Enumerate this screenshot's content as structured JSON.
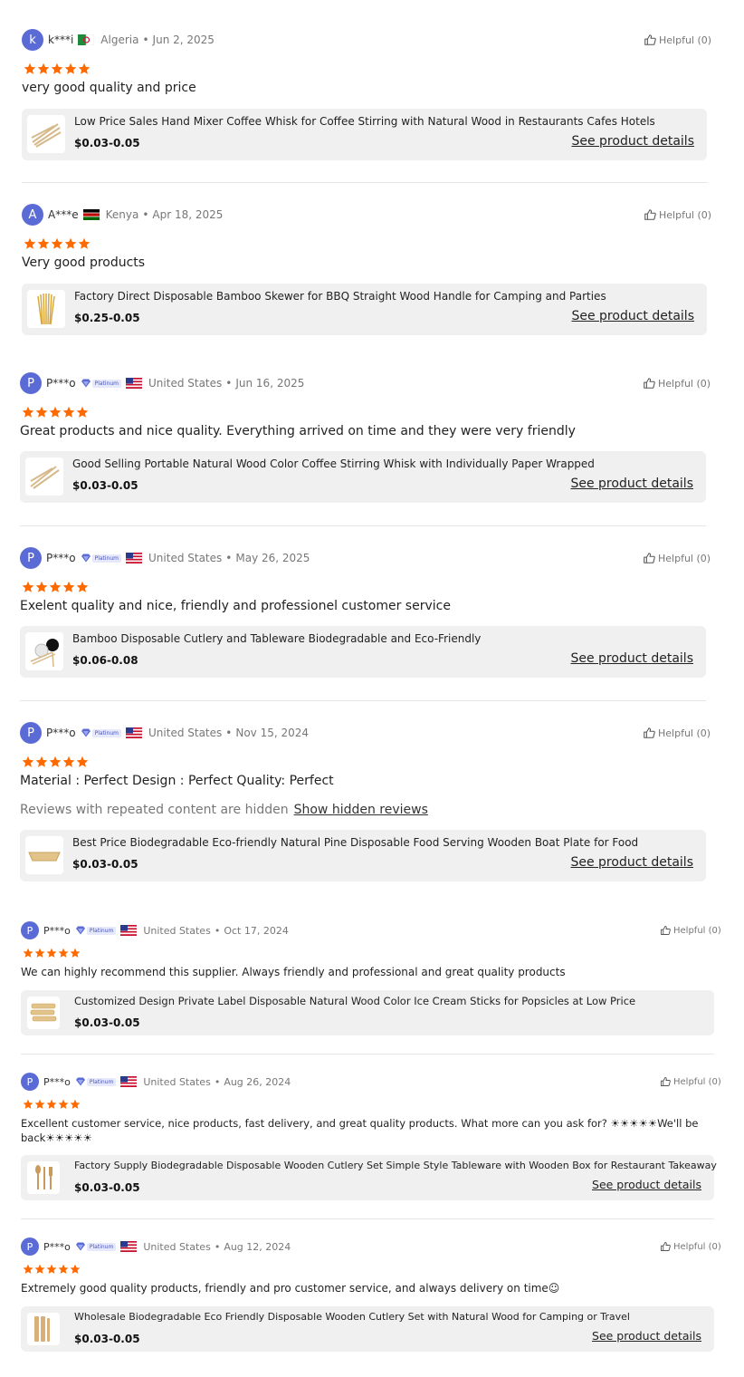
{
  "helpful_label": "Helpful (0)",
  "see_details_label": "See product details",
  "platinum_label": "Platinum",
  "hidden_reviews": {
    "text": "Reviews with repeated content are hidden",
    "link": "Show hidden reviews"
  },
  "reviews": [
    {
      "initial": "k",
      "user": "k***i",
      "country": "Algeria",
      "date": "Jun 2, 2025",
      "rating": 5,
      "text": "very good quality and price",
      "product_title": "Low Price Sales Hand Mixer Coffee Whisk for Coffee Stirring with Natural Wood in Restaurants Cafes Hotels",
      "product_price": "$0.03-0.05"
    },
    {
      "initial": "A",
      "user": "A***e",
      "country": "Kenya",
      "date": "Apr 18, 2025",
      "rating": 5,
      "text": "Very good products",
      "product_title": "Factory Direct Disposable Bamboo Skewer for BBQ Straight Wood Handle for Camping and Parties",
      "product_price": "$0.25-0.05"
    },
    {
      "initial": "P",
      "user": "P***o",
      "country": "United States",
      "date": "Jun 16, 2025",
      "rating": 5,
      "text": "Great products and nice quality. Everything arrived on time and they were very friendly",
      "product_title": "Good Selling Portable Natural Wood Color Coffee Stirring Whisk with Individually Paper Wrapped",
      "product_price": "$0.03-0.05"
    },
    {
      "initial": "P",
      "user": "P***o",
      "country": "United States",
      "date": "May 26, 2025",
      "rating": 5,
      "text": "Exelent quality and nice, friendly and professionel customer service",
      "product_title": "Bamboo Disposable Cutlery and Tableware Biodegradable and Eco-Friendly",
      "product_price": "$0.06-0.08"
    },
    {
      "initial": "P",
      "user": "P***o",
      "country": "United States",
      "date": "Nov 15, 2024",
      "rating": 5,
      "text": "Material : Perfect Design : Perfect Quality: Perfect",
      "product_title": "Best Price Biodegradable Eco-friendly Natural Pine Disposable Food Serving Wooden Boat Plate for Food",
      "product_price": "$0.03-0.05"
    },
    {
      "initial": "P",
      "user": "P***o",
      "country": "United States",
      "date": "Oct 17, 2024",
      "rating": 5,
      "text": "We can highly recommend this supplier. Always friendly and professional and great quality products",
      "product_title": "Customized Design Private Label Disposable Natural Wood Color Ice Cream Sticks for Popsicles at Low Price",
      "product_price": "$0.03-0.05"
    },
    {
      "initial": "P",
      "user": "P***o",
      "country": "United States",
      "date": "Aug 26, 2024",
      "rating": 5,
      "text": "Excellent customer service, nice products, fast delivery, and great quality products. What more can you ask for? ☀☀☀☀☀We'll be",
      "text2": "back☀☀☀☀☀",
      "product_title": "Factory Supply Biodegradable Disposable Wooden Cutlery Set Simple Style Tableware with Wooden Box for Restaurant Takeaway",
      "product_price": "$0.03-0.05"
    },
    {
      "initial": "P",
      "user": "P***o",
      "country": "United States",
      "date": "Aug 12, 2024",
      "rating": 5,
      "text": "Extremely good quality products, friendly and pro customer service, and always delivery on time☺",
      "product_title": "Wholesale Biodegradable Eco Friendly Disposable Wooden Cutlery Set with Natural Wood for Camping or Travel",
      "product_price": "$0.03-0.05"
    }
  ],
  "colors": {
    "star": "#ff6a00",
    "avatar": "#5b6bd5",
    "card_bg": "#f0f0f0"
  }
}
